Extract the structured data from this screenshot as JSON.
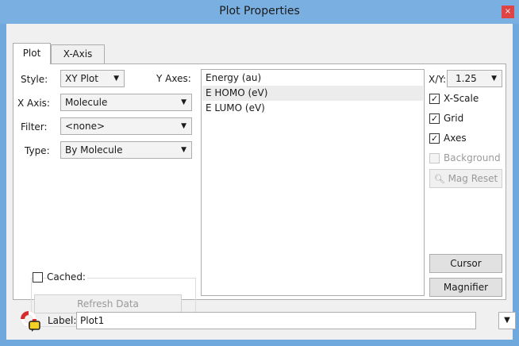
{
  "window": {
    "title": "Plot Properties",
    "close_glyph": "×"
  },
  "tabs": [
    {
      "label": "Plot"
    },
    {
      "label": "X-Axis"
    }
  ],
  "left": {
    "style": {
      "label": "Style:",
      "value": "XY Plot"
    },
    "x_axis": {
      "label": "X Axis:",
      "value": "Molecule"
    },
    "filter": {
      "label": "Filter:",
      "value": "<none>"
    },
    "type": {
      "label": "Type:",
      "value": "By Molecule"
    },
    "cached": {
      "label": "Cached:",
      "checked": false
    },
    "refresh_button": "Refresh Data"
  },
  "y_axes": {
    "label": "Y Axes:",
    "items": [
      {
        "label": "Energy (au)",
        "selected": false
      },
      {
        "label": "E HOMO (eV)",
        "selected": true
      },
      {
        "label": "E LUMO (eV)",
        "selected": false
      }
    ]
  },
  "right": {
    "xy": {
      "label": "X/Y:",
      "value": "1.25"
    },
    "x_scale": {
      "label": "X-Scale",
      "checked": true
    },
    "grid": {
      "label": "Grid",
      "checked": true
    },
    "axes": {
      "label": "Axes",
      "checked": true
    },
    "background": {
      "label": "Background",
      "checked": false,
      "disabled": true
    },
    "mag_reset_button": "Mag Reset",
    "cursor_button": "Cursor",
    "magnifier_button": "Magnifier"
  },
  "footer": {
    "label_caption": "Label:",
    "label_value": "Plot1",
    "help_icon": "lifebuoy-icon"
  },
  "glyphs": {
    "dropdown": "▼",
    "check": "✓"
  }
}
